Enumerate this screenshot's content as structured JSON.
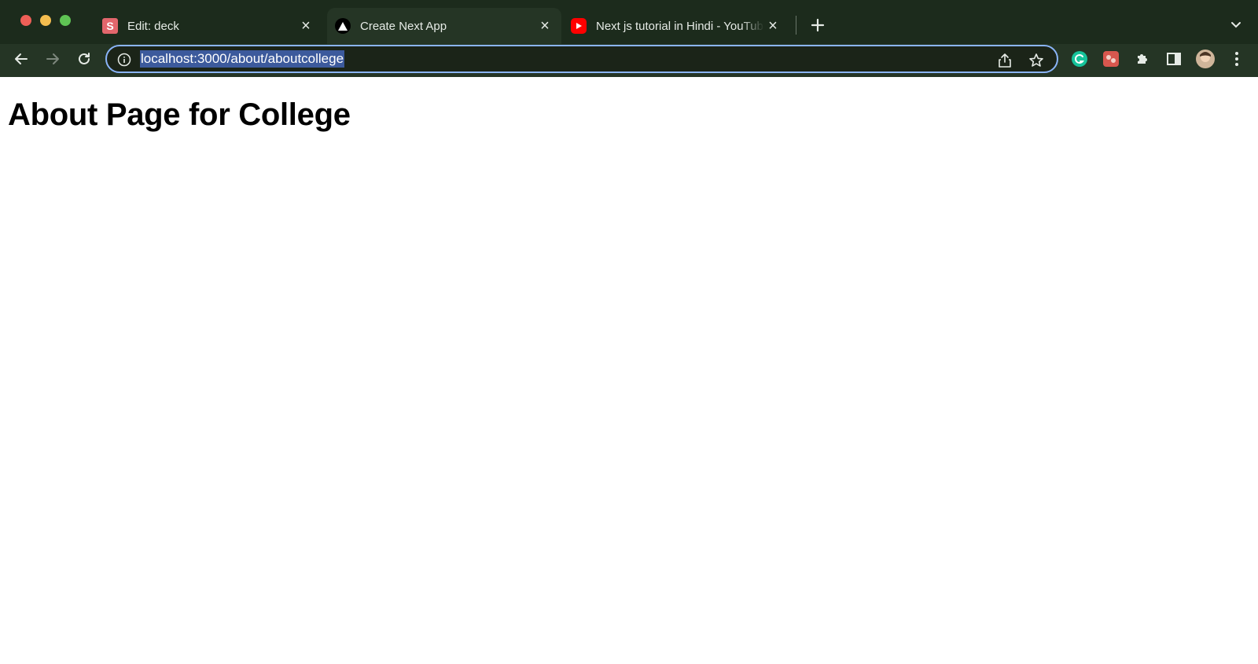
{
  "browser": {
    "tabs": [
      {
        "title": "Edit: deck",
        "favicon": "slides-s-icon",
        "favicon_letter": "S",
        "active": false
      },
      {
        "title": "Create Next App",
        "favicon": "nextjs-triangle-icon",
        "active": true
      },
      {
        "title": "Next js tutorial in Hindi - YouTube",
        "favicon": "youtube-icon",
        "active": false
      }
    ],
    "address_bar": {
      "url": "localhost:3000/about/aboutcollege",
      "selected": true
    },
    "colors": {
      "frame": "#1c2b1c",
      "toolbar": "#253525",
      "selection": "#3c5a9c",
      "focus_ring": "#8ab4f8"
    }
  },
  "page": {
    "heading": "About Page for College"
  }
}
